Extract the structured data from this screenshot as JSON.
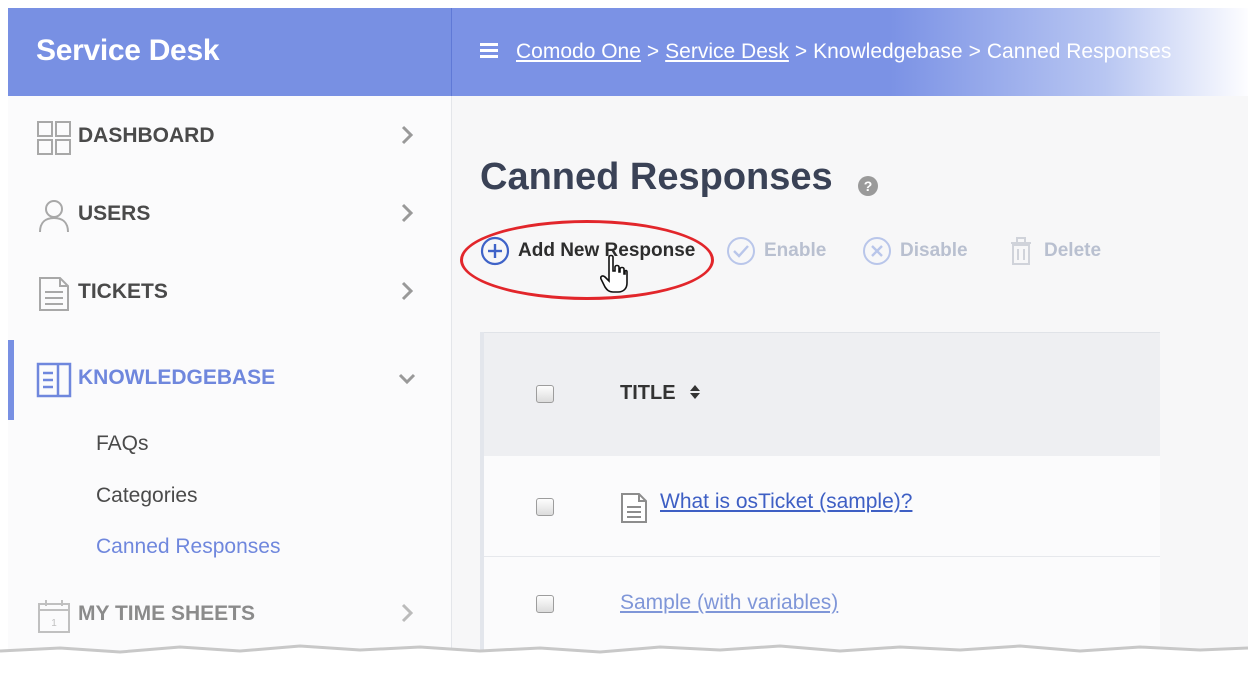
{
  "app": {
    "title": "Service Desk"
  },
  "breadcrumb": {
    "items": [
      {
        "label": "Comodo One",
        "link": true
      },
      {
        "label": "Service Desk",
        "link": true
      },
      {
        "label": "Knowledgebase",
        "link": false
      },
      {
        "label": "Canned Responses",
        "link": false
      }
    ],
    "separator": ">"
  },
  "sidebar": {
    "items": [
      {
        "label": "DASHBOARD",
        "icon": "dashboard-icon"
      },
      {
        "label": "USERS",
        "icon": "user-icon"
      },
      {
        "label": "TICKETS",
        "icon": "ticket-icon"
      },
      {
        "label": "KNOWLEDGEBASE",
        "icon": "knowledgebase-icon",
        "active": true,
        "children": [
          "FAQs",
          "Categories",
          "Canned Responses"
        ],
        "active_child": "Canned Responses"
      },
      {
        "label": "MY TIME SHEETS",
        "icon": "calendar-icon"
      }
    ]
  },
  "page": {
    "title": "Canned Responses",
    "help_icon": "?"
  },
  "toolbar": {
    "add_label": "Add New Response",
    "enable_label": "Enable",
    "disable_label": "Disable",
    "delete_label": "Delete"
  },
  "table": {
    "columns": [
      "TITLE"
    ],
    "rows": [
      {
        "title": "What is osTicket (sample)?"
      },
      {
        "title": "Sample (with variables)"
      }
    ]
  },
  "colors": {
    "brand": "#7890e3",
    "accent": "#6f87dd",
    "link": "#3e5fc4",
    "highlight": "#e2262b"
  }
}
